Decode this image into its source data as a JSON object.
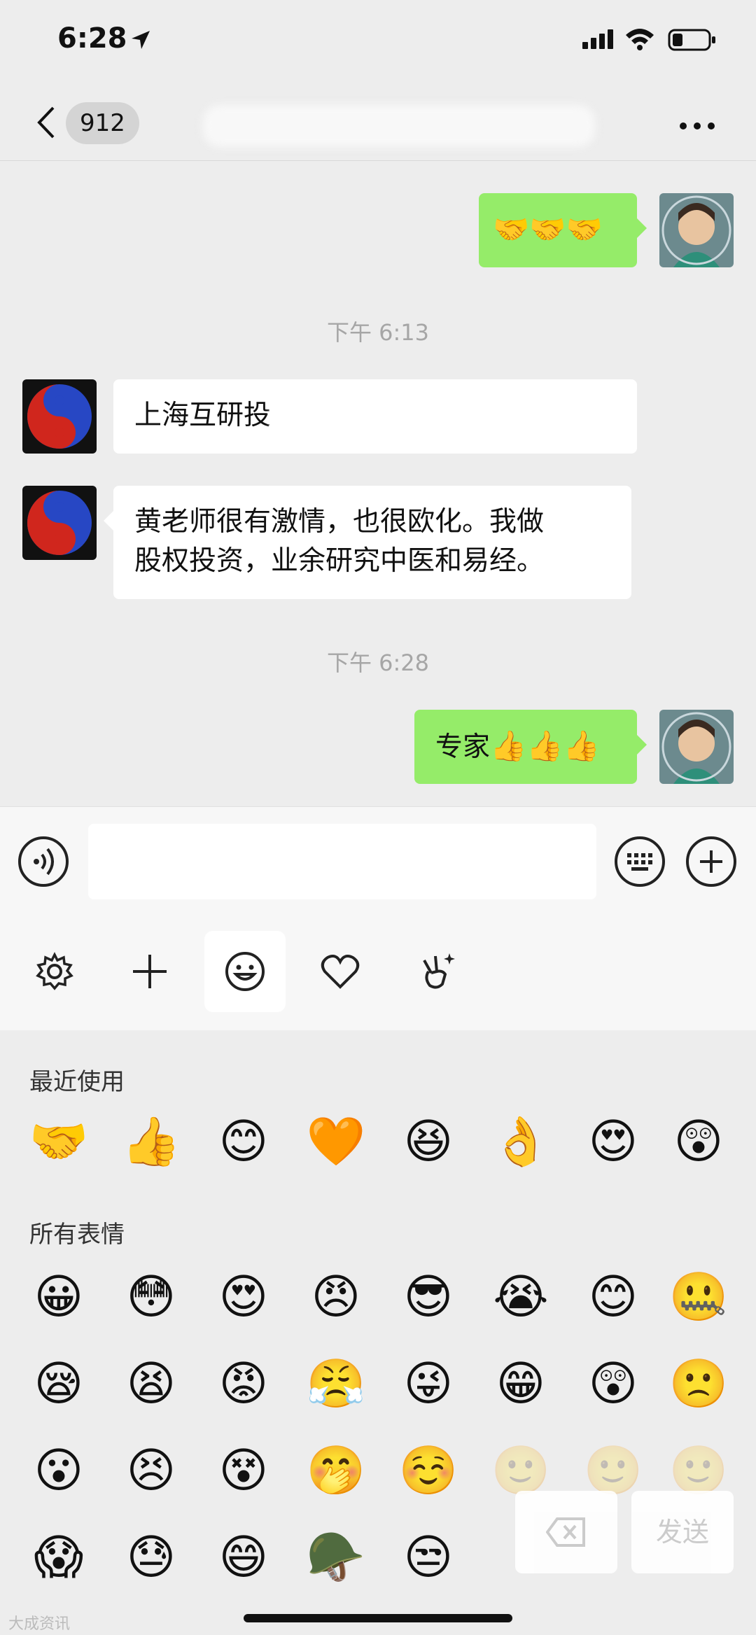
{
  "status_bar": {
    "time": "6:28"
  },
  "nav": {
    "unread_count": "912"
  },
  "messages": [
    {
      "side": "out",
      "emojis": [
        "🤝",
        "🤝",
        "🤝"
      ]
    },
    {
      "timestamp": "下午 6:13"
    },
    {
      "side": "in",
      "text": "上海互研投"
    },
    {
      "side": "in",
      "text_line1": "黄老师很有激情，也很欧化。我做",
      "text_line2": "股权投资，业余研究中医和易经。"
    },
    {
      "timestamp": "下午 6:28"
    },
    {
      "side": "out",
      "text": "专家",
      "emojis": [
        "👍",
        "👍",
        "👍"
      ]
    }
  ],
  "emoji_panel": {
    "recent_title": "最近使用",
    "all_title": "所有表情",
    "recent": [
      "🤝",
      "👍",
      "😊",
      "🧡",
      "😆",
      "👌",
      "😍",
      "😲"
    ],
    "all_rows": [
      [
        "😀",
        "😳",
        "😍",
        "😠",
        "😎",
        "😭",
        "😊",
        "🤐"
      ],
      [
        "😪",
        "😫",
        "😡",
        "😤",
        "😜",
        "😁",
        "😲",
        "🙁"
      ],
      [
        "😮",
        "😣",
        "😵",
        "🤭",
        "☺️",
        "🙂",
        "🙂",
        "🙂"
      ],
      [
        "😱",
        "😓",
        "😄",
        "🪖",
        "😒"
      ]
    ],
    "send_label": "发送"
  },
  "watermark": "大成资讯"
}
